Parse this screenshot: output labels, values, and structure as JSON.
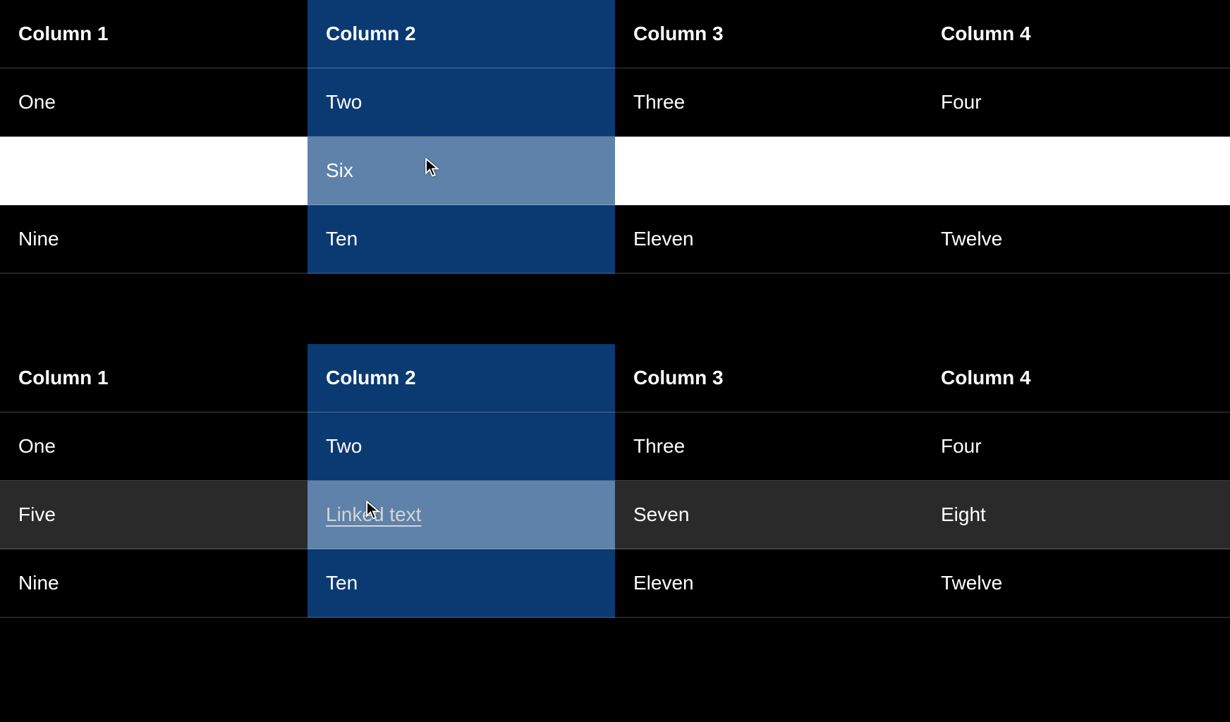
{
  "table1": {
    "headers": [
      "Column 1",
      "Column 2",
      "Column 3",
      "Column 4"
    ],
    "rows": [
      {
        "cells": [
          "One",
          "Two",
          "Three",
          "Four"
        ],
        "state": "normal"
      },
      {
        "cells": [
          "",
          "Six",
          "",
          ""
        ],
        "state": "selected",
        "cursor_col": 1
      },
      {
        "cells": [
          "Nine",
          "Ten",
          "Eleven",
          "Twelve"
        ],
        "state": "normal"
      }
    ],
    "highlight_col": 1
  },
  "table2": {
    "headers": [
      "Column 1",
      "Column 2",
      "Column 3",
      "Column 4"
    ],
    "rows": [
      {
        "cells": [
          "One",
          "Two",
          "Three",
          "Four"
        ],
        "state": "normal"
      },
      {
        "cells": [
          "Five",
          "Linked text",
          "Seven",
          "Eight"
        ],
        "state": "hover",
        "link_col": 1,
        "cursor_col": 1
      },
      {
        "cells": [
          "Nine",
          "Ten",
          "Eleven",
          "Twelve"
        ],
        "state": "normal"
      }
    ],
    "highlight_col": 1
  }
}
